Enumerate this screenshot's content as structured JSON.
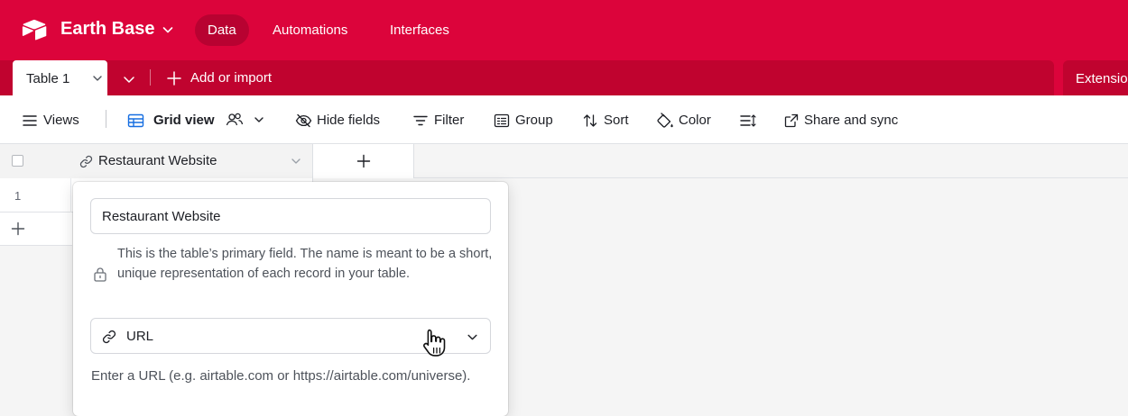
{
  "app": {
    "base_name": "Earth Base",
    "nav": [
      "Data",
      "Automations",
      "Interfaces"
    ],
    "active_nav": "Data",
    "brand_color": "#dc043b"
  },
  "tabs": {
    "table_tab": "Table 1",
    "add_or_import": "Add or import",
    "extensions": "Extensions"
  },
  "toolbar": {
    "views": "Views",
    "grid_view": "Grid view",
    "hide_fields": "Hide fields",
    "filter": "Filter",
    "group": "Group",
    "sort": "Sort",
    "color": "Color",
    "share_and_sync": "Share and sync"
  },
  "grid": {
    "primary_field": "Restaurant Website",
    "rows": [
      {
        "number": "1"
      }
    ]
  },
  "field_editor": {
    "name_value": "Restaurant Website",
    "primary_note": "This is the table’s primary field. The name is meant to be a short, unique representation of each record in your table.",
    "type_label": "URL",
    "type_description": "Enter a URL (e.g. airtable.com or https://airtable.com/universe)."
  }
}
